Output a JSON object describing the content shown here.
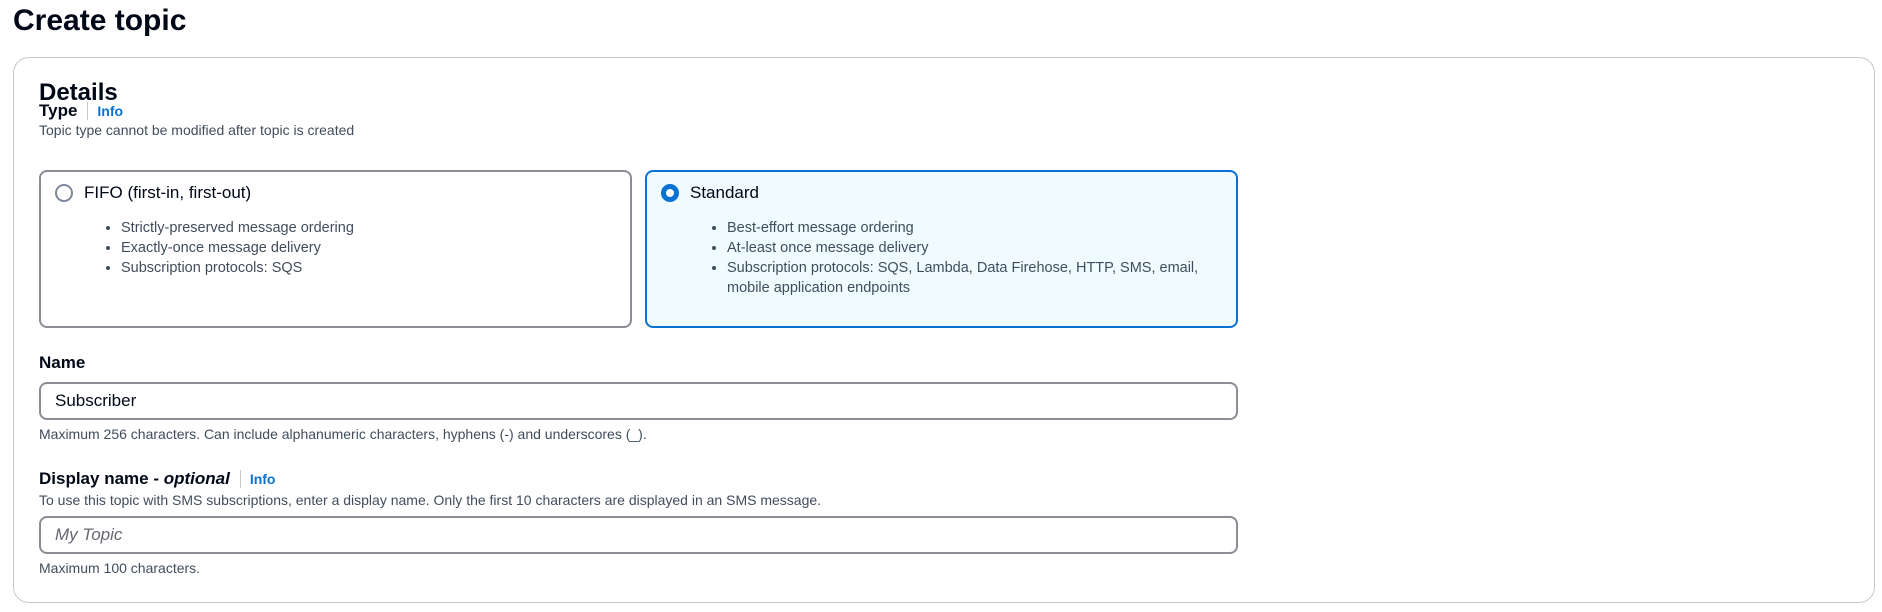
{
  "page": {
    "title": "Create topic"
  },
  "details": {
    "title": "Details",
    "type": {
      "label": "Type",
      "info": "Info",
      "description": "Topic type cannot be modified after topic is created",
      "options": [
        {
          "label": "FIFO (first-in, first-out)",
          "selected": false,
          "bullets": [
            "Strictly-preserved message ordering",
            "Exactly-once message delivery",
            "Subscription protocols: SQS"
          ]
        },
        {
          "label": "Standard",
          "selected": true,
          "bullets": [
            "Best-effort message ordering",
            "At-least once message delivery",
            "Subscription protocols: SQS, Lambda, Data Firehose, HTTP, SMS, email, mobile application endpoints"
          ]
        }
      ]
    },
    "name": {
      "label": "Name",
      "value": "Subscriber",
      "constraint": "Maximum 256 characters. Can include alphanumeric characters, hyphens (-) and underscores (_)."
    },
    "display_name": {
      "label": "Display name - ",
      "label_optional": "optional",
      "info": "Info",
      "description": "To use this topic with SMS subscriptions, enter a display name. Only the first 10 characters are displayed in an SMS message.",
      "value": "",
      "placeholder": "My Topic",
      "constraint": "Maximum 100 characters."
    }
  },
  "colors": {
    "accent": "#0972d3",
    "selected_tile_bg": "#f0fbff",
    "border": "#8c8c94",
    "text_secondary": "#414d5c"
  }
}
